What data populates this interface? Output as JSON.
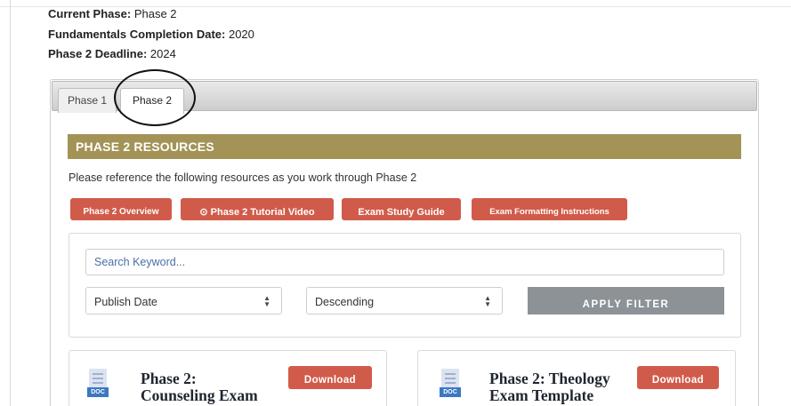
{
  "meta": {
    "current_phase_label": "Current Phase:",
    "current_phase_value": " Phase 2",
    "completion_label": "Fundamentals Completion Date:",
    "completion_value": " 2020",
    "deadline_label": "Phase 2 Deadline:",
    "deadline_value": " 2024"
  },
  "tabs": [
    {
      "label": "Phase 1"
    },
    {
      "label": "Phase 2"
    }
  ],
  "active_tab": "Phase 2",
  "resources": {
    "banner": "PHASE 2 RESOURCES",
    "intro": "Please reference the following resources as you work through Phase 2",
    "buttons": [
      {
        "label": "Phase 2 Overview"
      },
      {
        "label": "⊙ Phase 2 Tutorial Video",
        "icon": "play-circle-icon"
      },
      {
        "label": "Exam Study Guide"
      },
      {
        "label": "Exam Formatting Instructions"
      }
    ]
  },
  "filter": {
    "search_placeholder": "Search Keyword...",
    "sort_by": "Publish Date",
    "order": "Descending",
    "apply_label": "APPLY FILTER"
  },
  "cards": [
    {
      "title_line1": "Phase 2:",
      "title_line2": "Counseling Exam",
      "file_type": "DOC",
      "download_label": "Download"
    },
    {
      "title_line1": "Phase 2: Theology",
      "title_line2": "Exam Template",
      "file_type": "DOC",
      "download_label": "Download"
    }
  ],
  "colors": {
    "banner": "#a39356",
    "accent_red": "#d15b4a",
    "apply_gray": "#8d9296",
    "doc_blue": "#3b78c2"
  }
}
